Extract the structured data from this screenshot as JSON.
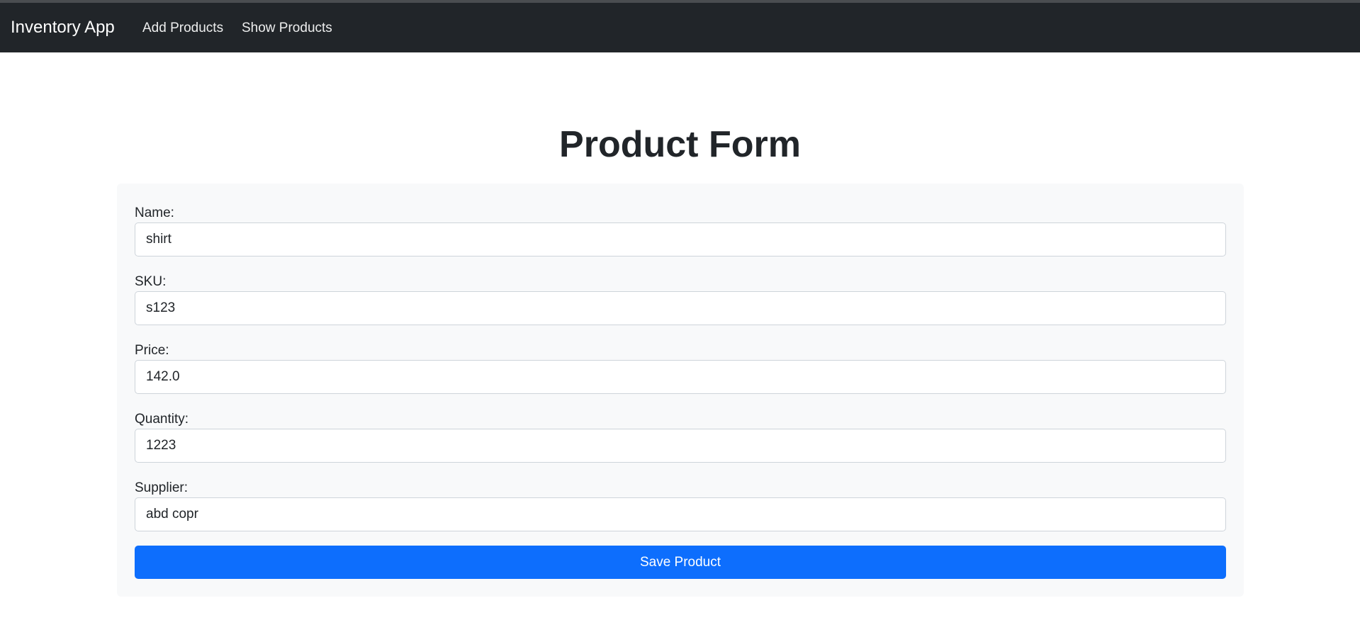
{
  "navbar": {
    "brand": "Inventory App",
    "links": [
      "Add Products",
      "Show Products"
    ]
  },
  "page": {
    "title": "Product Form"
  },
  "form": {
    "fields": [
      {
        "label": "Name:",
        "value": "shirt"
      },
      {
        "label": "SKU:",
        "value": "s123"
      },
      {
        "label": "Price:",
        "value": "142.0"
      },
      {
        "label": "Quantity:",
        "value": "1223"
      },
      {
        "label": "Supplier:",
        "value": "abd copr"
      }
    ],
    "submit_label": "Save Product"
  },
  "colors": {
    "navbar_bg": "#212529",
    "form_bg": "#f8f9fa",
    "primary_button": "#0d6efd"
  }
}
